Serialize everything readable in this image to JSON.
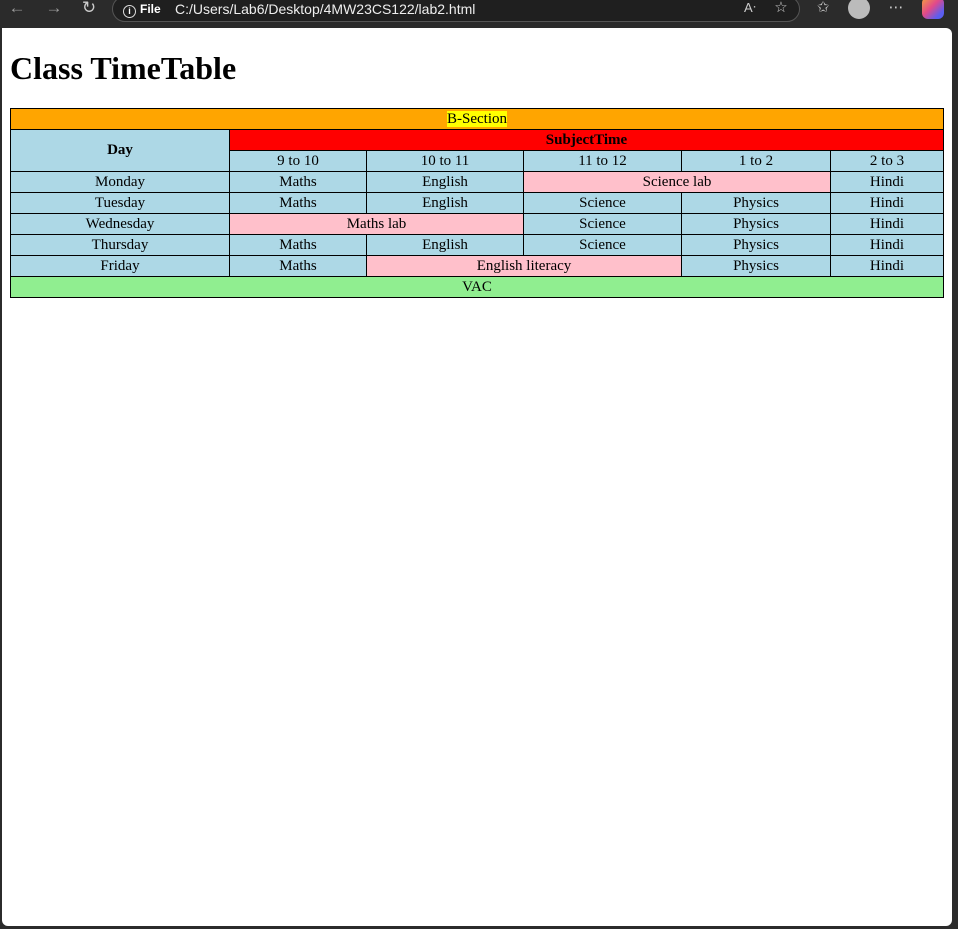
{
  "browser": {
    "file_label": "File",
    "url": "C:/Users/Lab6/Desktop/4MW23CS122/lab2.html"
  },
  "page": {
    "heading": "Class TimeTable"
  },
  "table": {
    "section": "B-Section",
    "day_header": "Day",
    "subject_time_header": "SubjectTime",
    "times": [
      "9 to 10",
      "10 to 11",
      "11 to 12",
      "1 to 2",
      "2 to 3"
    ],
    "rows": {
      "monday": {
        "day": "Monday",
        "c1": "Maths",
        "c2": "English",
        "lab": "Science lab",
        "c5": "Hindi"
      },
      "tuesday": {
        "day": "Tuesday",
        "c1": "Maths",
        "c2": "English",
        "c3": "Science",
        "c4": "Physics",
        "c5": "Hindi"
      },
      "wednesday": {
        "day": "Wednesday",
        "lab": "Maths lab",
        "c3": "Science",
        "c4": "Physics",
        "c5": "Hindi"
      },
      "thursday": {
        "day": "Thursday",
        "c1": "Maths",
        "c2": "English",
        "c3": "Science",
        "c4": "Physics",
        "c5": "Hindi"
      },
      "friday": {
        "day": "Friday",
        "c1": "Maths",
        "lab": "English literacy",
        "c4": "Physics",
        "c5": "Hindi"
      }
    },
    "footer": "VAC"
  },
  "colors": {
    "section_row": "#ffa500",
    "section_highlight": "#ffff00",
    "cell_bg": "#add8e6",
    "subject_time_bg": "#ff0000",
    "lab_bg": "#ffc0cb",
    "footer_bg": "#90ee90"
  }
}
